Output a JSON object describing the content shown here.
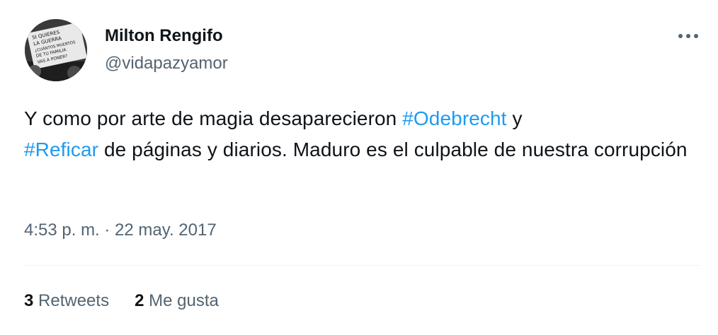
{
  "tweet": {
    "author_name": "Milton Rengifo",
    "author_handle": "@vidapazyamor",
    "text_part1": "Y como por arte de magia desaparecieron ",
    "hashtag1": "#Odebrecht",
    "text_part2": " y ",
    "hashtag2": "#Reficar",
    "text_part3": " de páginas y diarios. Maduro es el culpable de nuestra corrupción",
    "timestamp": "4:53 p. m. · 22 may. 2017",
    "retweets_count": "3",
    "retweets_label": "Retweets",
    "likes_count": "2",
    "likes_label": "Me gusta"
  },
  "avatar": {
    "sign_line1": "SI QUIERES",
    "sign_line2": "LA GUERRA",
    "sign_line3": "¿CUÁNTOS MUERTOS",
    "sign_line4": "DE TU FAMILIA",
    "sign_line5": "VAS A PONER?"
  },
  "colors": {
    "accent": "#1d9bf0",
    "text": "#0f1419",
    "muted": "#536471",
    "divider": "#eff3f4"
  },
  "icons": {
    "more": "more-horizontal-icon"
  }
}
